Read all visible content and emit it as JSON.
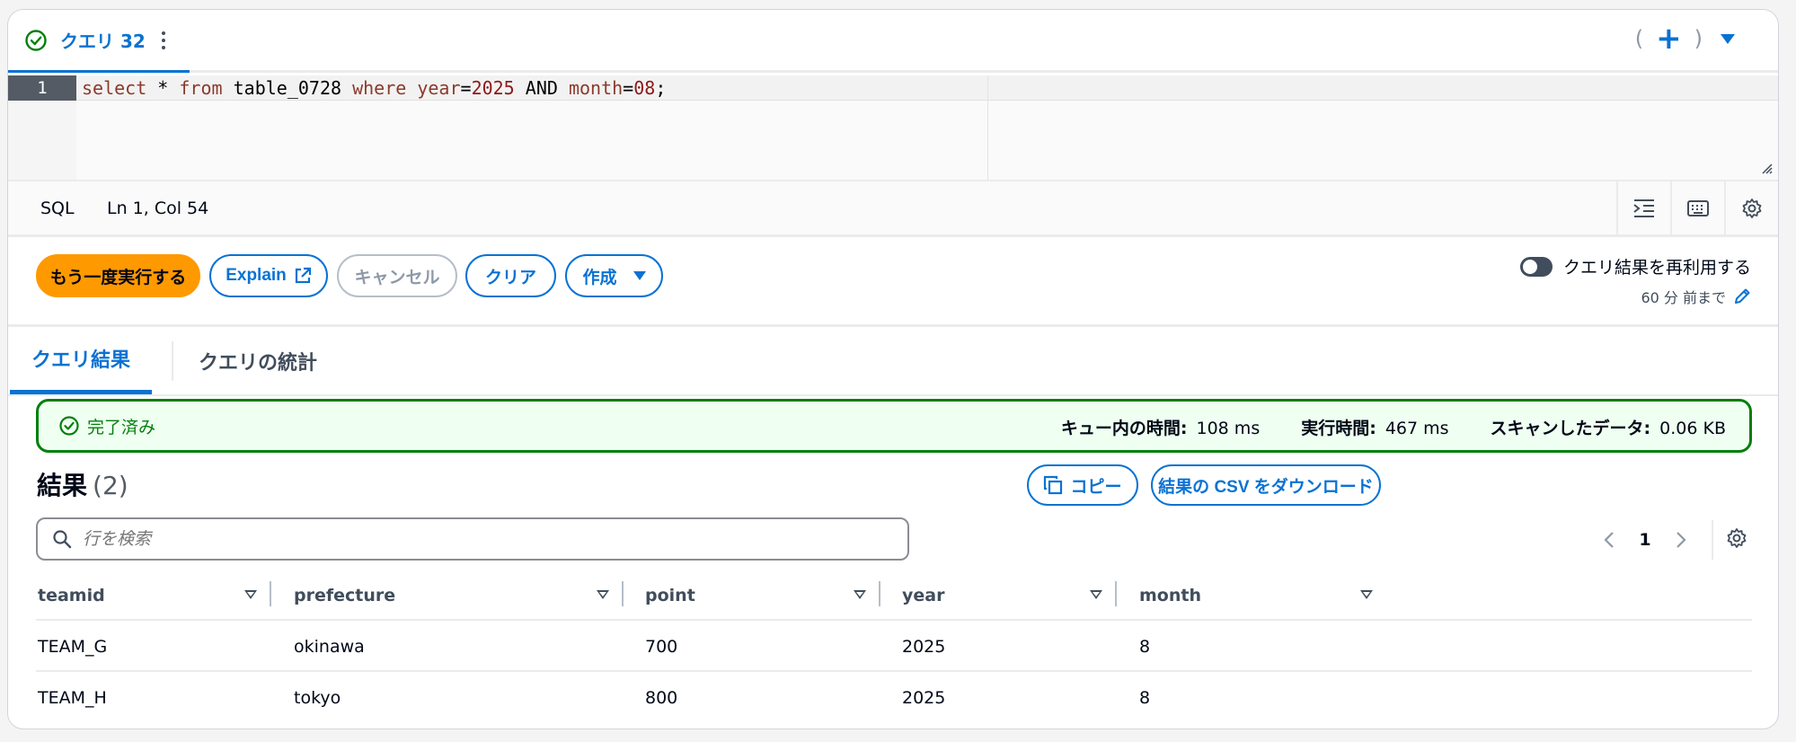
{
  "query_tab": {
    "title": "クエリ 32",
    "status": "success"
  },
  "editor": {
    "line_number": "1",
    "language": "SQL",
    "cursor": "Ln 1, Col 54",
    "sql": "select * from table_0728 where year=2025 AND month=08;"
  },
  "toolbar": {
    "run_again": "もう一度実行する",
    "explain": "Explain",
    "cancel": "キャンセル",
    "clear": "クリア",
    "create": "作成"
  },
  "reuse": {
    "label": "クエリ結果を再利用する",
    "enabled": false,
    "age": "60 分 前まで"
  },
  "result_tabs": [
    "クエリ結果",
    "クエリの統計"
  ],
  "banner": {
    "status": "完了済み",
    "queue_label": "キュー内の時間:",
    "queue_value": "108 ms",
    "exec_label": "実行時間:",
    "exec_value": "467 ms",
    "scan_label": "スキャンしたデータ:",
    "scan_value": "0.06 KB"
  },
  "results": {
    "title": "結果",
    "count": "(2)",
    "copy": "コピー",
    "download": "結果の CSV をダウンロード",
    "search_placeholder": "行を検索",
    "page": "1",
    "columns": [
      "teamid",
      "prefecture",
      "point",
      "year",
      "month"
    ],
    "rows": [
      [
        "TEAM_G",
        "okinawa",
        "700",
        "2025",
        "8"
      ],
      [
        "TEAM_H",
        "tokyo",
        "800",
        "2025",
        "8"
      ]
    ]
  },
  "colors": {
    "accent": "#0972d3",
    "primary_button": "#ff9900",
    "success": "#037f0c"
  }
}
